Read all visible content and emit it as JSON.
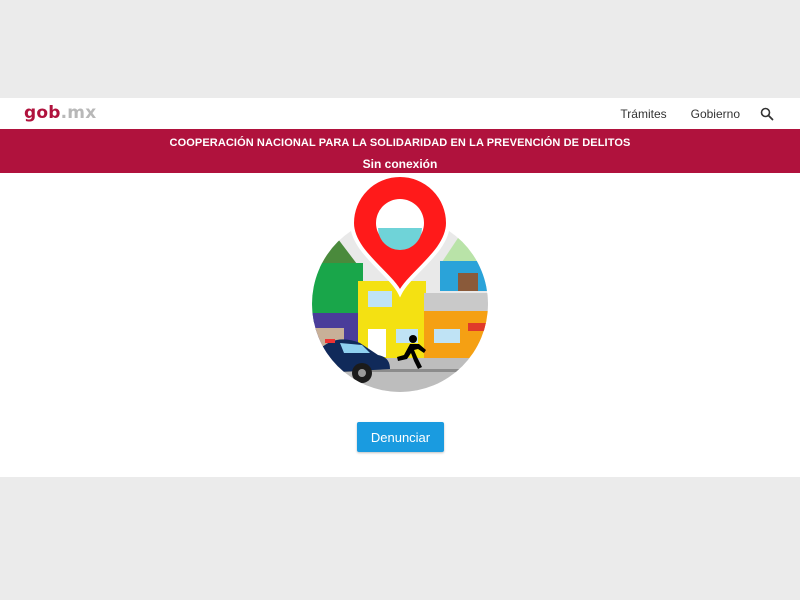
{
  "header": {
    "logo_main": "gob",
    "logo_suffix": ".mx",
    "nav": [
      {
        "label": "Trámites"
      },
      {
        "label": "Gobierno"
      }
    ],
    "search_icon": "search-icon"
  },
  "banner": {
    "title": "COOPERACIÓN NACIONAL PARA LA SOLIDARIDAD EN LA PREVENCIÓN DE DELITOS",
    "status": "Sin conexión"
  },
  "main": {
    "illustration_icon": "crime-location-illustration",
    "report_button_label": "Denunciar"
  },
  "colors": {
    "brand": "#b0123d",
    "button": "#1a9be0",
    "pin": "#ff1a1a",
    "page_background": "#ebebeb"
  }
}
